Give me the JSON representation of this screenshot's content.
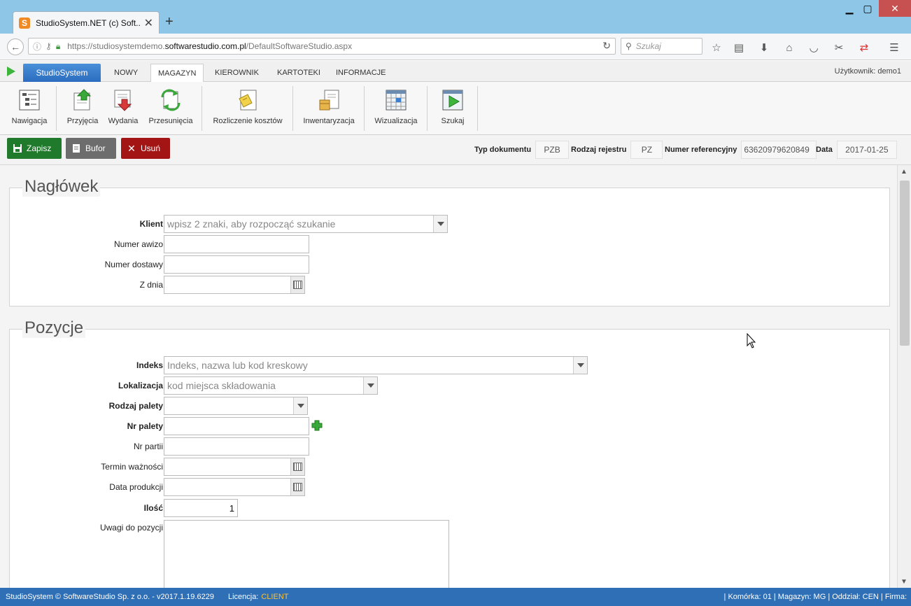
{
  "browser": {
    "tab_title": "StudioSystem.NET (c) Soft...",
    "url_prefix": "https://studiosystemdemo.",
    "url_host": "softwarestudio.com.pl",
    "url_path": "/DefaultSoftwareStudio.aspx",
    "search_placeholder": "Szukaj"
  },
  "menu": {
    "brand": "StudioSystem",
    "tabs": [
      "NOWY",
      "MAGAZYN",
      "KIEROWNIK",
      "KARTOTEKI",
      "INFORMACJE"
    ],
    "active_tab": "MAGAZYN",
    "user": "Użytkownik: demo1"
  },
  "ribbon": {
    "items": [
      "Nawigacja",
      "Przyjęcia",
      "Wydania",
      "Przesunięcia",
      "Rozliczenie kosztów",
      "Inwentaryzacja",
      "Wizualizacja",
      "Szukaj"
    ]
  },
  "actions": {
    "save": "Zapisz",
    "buffer": "Bufor",
    "delete": "Usuń"
  },
  "doc_meta": {
    "doc_type_label": "Typ dokumentu",
    "doc_type_value": "PZB",
    "register_label": "Rodzaj rejestru",
    "register_value": "PZ",
    "ref_label": "Numer referencyjny",
    "ref_value": "63620979620849",
    "date_label": "Data",
    "date_value": "2017-01-25"
  },
  "header_section": {
    "title": "Nagłówek",
    "client_label": "Klient",
    "client_placeholder": "wpisz 2 znaki, aby rozpocząć szukanie",
    "advice_label": "Numer awizo",
    "delivery_label": "Numer dostawy",
    "date_label": "Z dnia"
  },
  "positions_section": {
    "title": "Pozycje",
    "index_label": "Indeks",
    "index_placeholder": "Indeks, nazwa lub kod kreskowy",
    "location_label": "Lokalizacja",
    "location_placeholder": "kod miejsca składowania",
    "pallet_type_label": "Rodzaj palety",
    "pallet_no_label": "Nr palety",
    "batch_label": "Nr partii",
    "expiry_label": "Termin ważności",
    "production_label": "Data produkcji",
    "qty_label": "Ilość",
    "qty_value": "1",
    "notes_label": "Uwagi do pozycji"
  },
  "status": {
    "copyright": "StudioSystem © SoftwareStudio Sp. z o.o. - v2017.1.19.6229",
    "license_label": "Licencja:",
    "license_value": "CLIENT",
    "right": "| Komórka: 01 | Magazyn: MG | Oddział: CEN | Firma:"
  }
}
